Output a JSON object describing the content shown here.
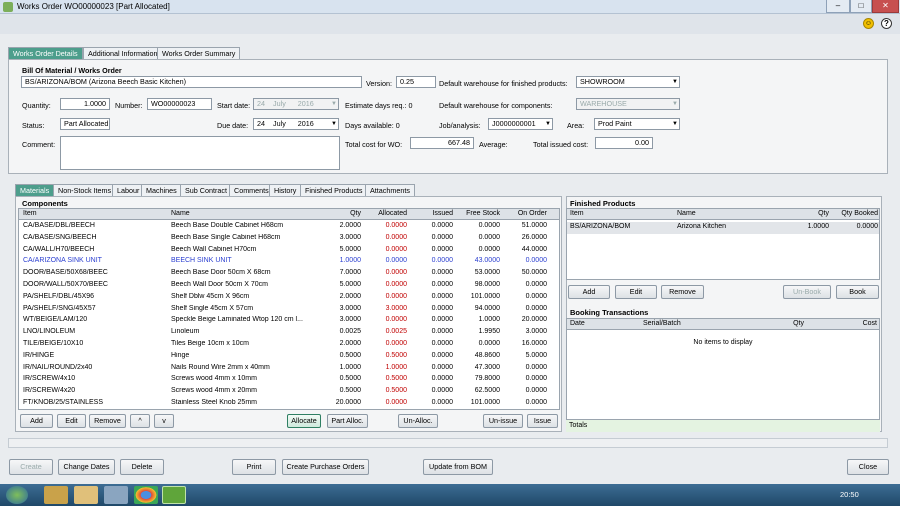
{
  "window": {
    "title": "Works Order WO00000023 [Part Allocated]",
    "min": "–",
    "max": "□",
    "close": "✕"
  },
  "main_tabs": [
    "Works Order Details",
    "Additional Information",
    "Works Order Summary"
  ],
  "header": {
    "section_title": "Bill Of Material / Works Order",
    "bom": "BS/ARIZONA/BOM  (Arizona Beech Basic Kitchen)",
    "version_label": "Version:",
    "version": "0.25",
    "default_wh_fin_label": "Default warehouse for finished products:",
    "default_wh_fin": "SHOWROOM",
    "quantity_label": "Quantity:",
    "quantity": "1.0000",
    "number_label": "Number:",
    "number": "WO00000023",
    "start_date_label": "Start date:",
    "start_day": "24",
    "start_month": "July",
    "start_year": "2016",
    "est_days_label": "Estimate days req.: 0",
    "default_wh_comp_label": "Default warehouse for components:",
    "default_wh_comp": "WAREHOUSE",
    "status_label": "Status:",
    "status": "Part Allocated",
    "due_date_label": "Due date:",
    "due_day": "24",
    "due_month": "July",
    "due_year": "2016",
    "days_avail_label": "Days available: 0",
    "job_label": "Job/analysis:",
    "job": "J0000000001",
    "area_label": "Area:",
    "area": "Prod Paint",
    "comment_label": "Comment:",
    "total_cost_label": "Total cost for WO:",
    "total_cost": "667.48",
    "average_label": "Average:",
    "total_issued_label": "Total issued cost:",
    "total_issued": "0.00"
  },
  "sub_tabs": [
    "Materials",
    "Non-Stock Items",
    "Labour",
    "Machines",
    "Sub Contract",
    "Comments",
    "History",
    "Finished Products",
    "Attachments"
  ],
  "components": {
    "title": "Components",
    "columns": [
      "Item",
      "Name",
      "Qty",
      "Allocated",
      "Issued",
      "Free Stock",
      "On Order"
    ],
    "rows": [
      [
        "CA/BASE/DBL/BEECH",
        "Beech Base Double Cabinet H68cm",
        "2.0000",
        "0.0000",
        "0.0000",
        "0.0000",
        "51.0000"
      ],
      [
        "CA/BASE/SNG/BEECH",
        "Beech Base Single Cabinet H68cm",
        "3.0000",
        "0.0000",
        "0.0000",
        "0.0000",
        "26.0000"
      ],
      [
        "CA/WALL/H70/BEECH",
        "Beech Wall Cabinet H70cm",
        "5.0000",
        "0.0000",
        "0.0000",
        "0.0000",
        "44.0000"
      ],
      [
        "CA/ARIZONA SINK UNIT",
        "BEECH SINK UNIT",
        "1.0000",
        "0.0000",
        "0.0000",
        "43.0000",
        "0.0000"
      ],
      [
        "DOOR/BASE/50X68/BEEC",
        "Beech Base Door 50cm X 68cm",
        "7.0000",
        "0.0000",
        "0.0000",
        "53.0000",
        "50.0000"
      ],
      [
        "DOOR/WALL/50X70/BEEC",
        "Beech Wall Door 50cm X 70cm",
        "5.0000",
        "0.0000",
        "0.0000",
        "98.0000",
        "0.0000"
      ],
      [
        "PA/SHELF/DBL/45X96",
        "Shelf Dblw 45cm X 96cm",
        "2.0000",
        "0.0000",
        "0.0000",
        "101.0000",
        "0.0000"
      ],
      [
        "PA/SHELF/SNG/45X57",
        "Shelf  Single 45cm X 57cm",
        "3.0000",
        "3.0000",
        "0.0000",
        "94.0000",
        "0.0000"
      ],
      [
        "WT/BEIGE/LAM/120",
        "Speckle Beige Laminated Wtop 120 cm l...",
        "3.0000",
        "0.0000",
        "0.0000",
        "1.0000",
        "20.0000"
      ],
      [
        "LNO/LINOLEUM",
        "Linoleum",
        "0.0025",
        "0.0025",
        "0.0000",
        "1.9950",
        "3.0000"
      ],
      [
        "TILE/BEIGE/10X10",
        "Tiles Beige 10cm x 10cm",
        "2.0000",
        "0.0000",
        "0.0000",
        "0.0000",
        "16.0000"
      ],
      [
        "IR/HINGE",
        "Hinge",
        "0.5000",
        "0.5000",
        "0.0000",
        "48.8600",
        "5.0000"
      ],
      [
        "IR/NAIL/ROUND/2x40",
        "Nails Round Wire 2mm x 40mm",
        "1.0000",
        "1.0000",
        "0.0000",
        "47.3000",
        "0.0000"
      ],
      [
        "IR/SCREW/4x10",
        "Screws wood 4mm x 10mm",
        "0.5000",
        "0.5000",
        "0.0000",
        "79.8000",
        "0.0000"
      ],
      [
        "IR/SCREW/4x20",
        "Screws wood 4mm x 20mm",
        "0.5000",
        "0.5000",
        "0.0000",
        "62.5000",
        "0.0000"
      ],
      [
        "FT/KNOB/25/STAINLESS",
        "Stainless Steel Knob 25mm",
        "20.0000",
        "0.0000",
        "0.0000",
        "101.0000",
        "0.0000"
      ]
    ],
    "buttons": {
      "add": "Add",
      "edit": "Edit",
      "remove": "Remove",
      "up": "^",
      "down": "v",
      "allocate": "Allocate",
      "part_alloc": "Part Alloc.",
      "un_alloc": "Un-Alloc.",
      "un_issue": "Un-issue",
      "issue": "Issue"
    }
  },
  "finished_products": {
    "title": "Finished Products",
    "columns": [
      "Item",
      "Name",
      "Qty",
      "Qty Booked"
    ],
    "rows": [
      [
        "BS/ARIZONA/BOM",
        "Arizona Kitchen",
        "1.0000",
        "0.0000"
      ]
    ],
    "buttons": {
      "add": "Add",
      "edit": "Edit",
      "remove": "Remove",
      "un_book": "Un-Book",
      "book": "Book"
    }
  },
  "booking": {
    "title": "Booking Transactions",
    "columns": [
      "Date",
      "Serial/Batch",
      "Qty",
      "Cost"
    ],
    "empty": "No items to display",
    "totals": "Totals"
  },
  "bottom_buttons": {
    "create": "Create",
    "change_dates": "Change Dates",
    "delete": "Delete",
    "print": "Print",
    "create_po": "Create Purchase Orders",
    "update_bom": "Update from BOM",
    "close": "Close"
  },
  "taskbar": {
    "clock": "20:50"
  },
  "colors": {
    "accent": "#4d9e8c",
    "red_value": "#c00000",
    "blue_row": "#2a3ed0"
  }
}
